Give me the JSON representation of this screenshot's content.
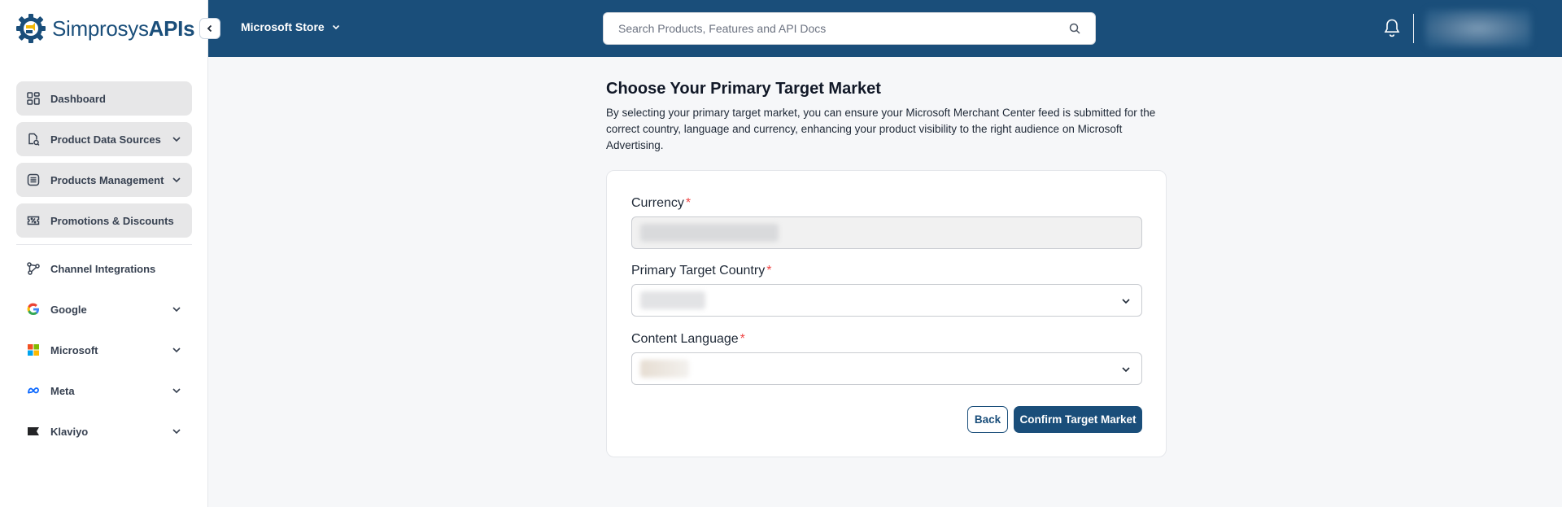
{
  "brand": {
    "name_regular": "Simprosys",
    "name_bold": "APIs",
    "color": "#1a4e7a"
  },
  "sidebar": {
    "items": [
      {
        "label": "Dashboard",
        "icon": "grid-icon",
        "expandable": false
      },
      {
        "label": "Product Data Sources",
        "icon": "data-source-icon",
        "expandable": true
      },
      {
        "label": "Products Management",
        "icon": "products-list-icon",
        "expandable": true
      },
      {
        "label": "Promotions & Discounts",
        "icon": "coupon-icon",
        "expandable": false
      },
      {
        "label": "Channel Integrations",
        "icon": "integrations-icon",
        "expandable": false
      },
      {
        "label": "Google",
        "icon": "google-icon",
        "expandable": true
      },
      {
        "label": "Microsoft",
        "icon": "microsoft-icon",
        "expandable": true
      },
      {
        "label": "Meta",
        "icon": "meta-icon",
        "expandable": true
      },
      {
        "label": "Klaviyo",
        "icon": "klaviyo-icon",
        "expandable": true
      }
    ]
  },
  "header": {
    "store_label": "Microsoft Store",
    "search_placeholder": "Search Products, Features and API Docs",
    "bg_color": "#1a4e7a"
  },
  "main": {
    "title": "Choose Your Primary Target Market",
    "description": "By selecting your primary target market, you can ensure your Microsoft Merchant Center feed is submitted for the correct country, language and currency, enhancing your product visibility to the right audience on Microsoft Advertising.",
    "form": {
      "currency_label": "Currency",
      "country_label": "Primary Target Country",
      "language_label": "Content Language",
      "required_mark": "*",
      "back_label": "Back",
      "confirm_label": "Confirm Target Market"
    }
  },
  "colors": {
    "required": "#ef4444",
    "page_bg": "#f6f7f9"
  }
}
